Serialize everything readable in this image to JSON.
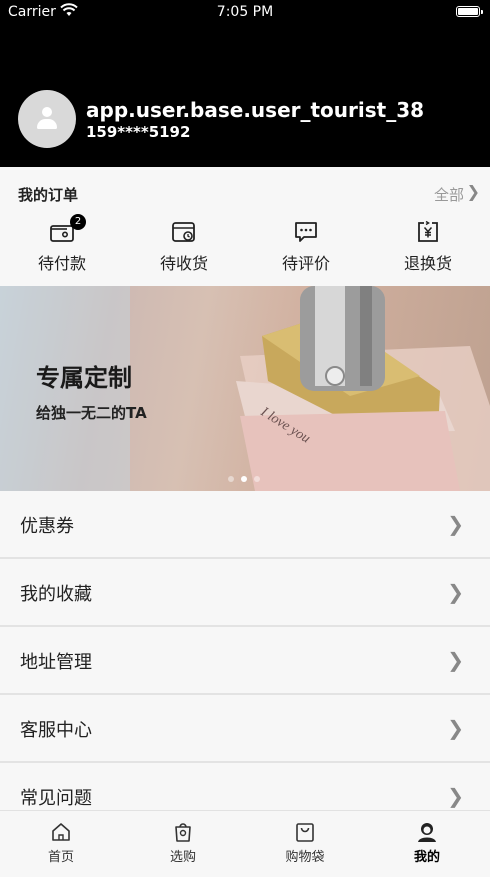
{
  "status_bar": {
    "carrier": "Carrier",
    "time": "7:05 PM"
  },
  "profile": {
    "username": "app.user.base.user_tourist_38",
    "phone": "159****5192"
  },
  "orders": {
    "title": "我的订单",
    "all_label": "全部",
    "items": [
      {
        "label": "待付款",
        "icon": "wallet-icon",
        "badge": "2"
      },
      {
        "label": "待收货",
        "icon": "package-clock-icon"
      },
      {
        "label": "待评价",
        "icon": "comment-icon"
      },
      {
        "label": "退换货",
        "icon": "yen-return-icon"
      }
    ]
  },
  "banner": {
    "title": "专属定制",
    "subtitle": "给独一无二的TA",
    "engraving": "I love you",
    "active_index": 1,
    "total": 3
  },
  "menu": [
    {
      "label": "优惠券"
    },
    {
      "label": "我的收藏"
    },
    {
      "label": "地址管理"
    },
    {
      "label": "客服中心"
    },
    {
      "label": "常见问题"
    }
  ],
  "tabbar": [
    {
      "label": "首页",
      "icon": "home-icon"
    },
    {
      "label": "选购",
      "icon": "shopping-bag-icon"
    },
    {
      "label": "购物袋",
      "icon": "cart-bag-icon"
    },
    {
      "label": "我的",
      "icon": "user-icon",
      "active": true
    }
  ]
}
